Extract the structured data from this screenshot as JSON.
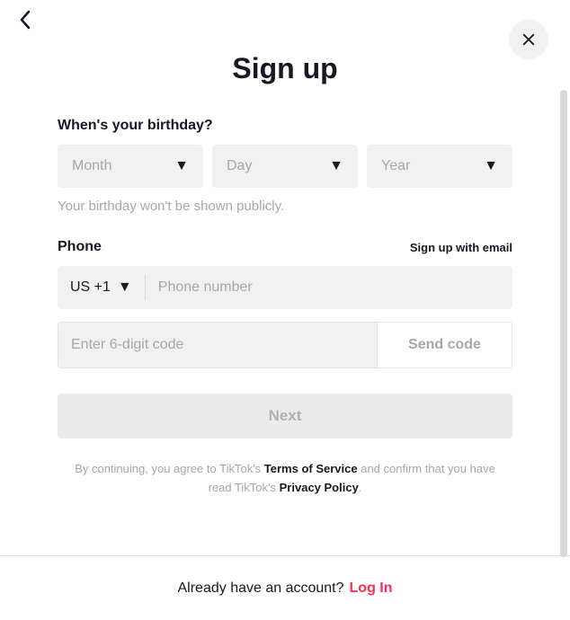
{
  "title": "Sign up",
  "birthday": {
    "label": "When's your birthday?",
    "month": "Month",
    "day": "Day",
    "year": "Year",
    "hint": "Your birthday won't be shown publicly."
  },
  "phone": {
    "label": "Phone",
    "email_link": "Sign up with email",
    "country_code": "US +1",
    "placeholder": "Phone number"
  },
  "code": {
    "placeholder": "Enter 6-digit code",
    "send_label": "Send code"
  },
  "next_label": "Next",
  "legal": {
    "prefix": "By continuing, you agree to TikTok's ",
    "tos": "Terms of Service",
    "mid": " and confirm that you have read TikTok's ",
    "privacy": "Privacy Policy",
    "suffix": "."
  },
  "footer": {
    "text": "Already have an account?",
    "login": "Log In"
  }
}
